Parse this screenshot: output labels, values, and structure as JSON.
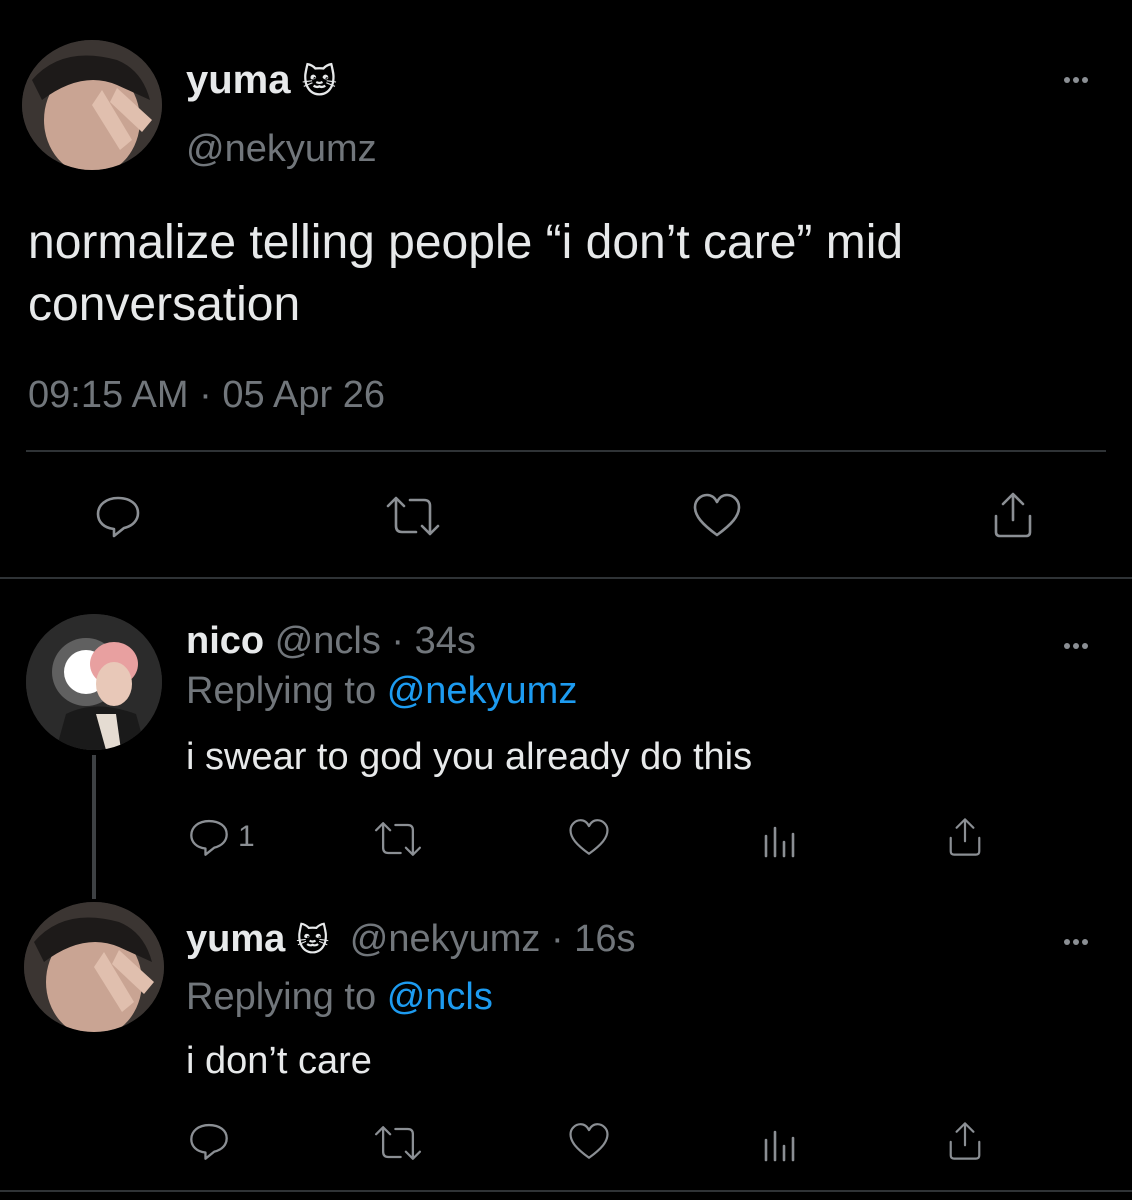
{
  "main_tweet": {
    "display_name": "yuma",
    "handle": "@nekyumz",
    "badge_emoji": "🐱",
    "text": "normalize telling people “i don’t care” mid conversation",
    "timestamp": "09:15 AM · 05 Apr 26",
    "actions": [
      "reply-icon",
      "retweet-icon",
      "like-icon",
      "share-icon"
    ]
  },
  "replies": [
    {
      "display_name": "nico",
      "handle": "@ncls",
      "age": "· 34s",
      "replying_prefix": "Replying to",
      "replying_to": "@nekyumz",
      "text": "i swear to god you already do this",
      "reply_count": "1"
    },
    {
      "display_name": "yuma",
      "badge_emoji": "🐱",
      "handle": "@nekyumz",
      "age": "· 16s",
      "replying_prefix": "Replying to",
      "replying_to": "@ncls",
      "text": "i don’t care",
      "reply_count": ""
    }
  ],
  "colors": {
    "background": "#000000",
    "text": "#e7e9ea",
    "muted": "#71767b",
    "link": "#1d9bf0",
    "divider": "#2f3336"
  }
}
